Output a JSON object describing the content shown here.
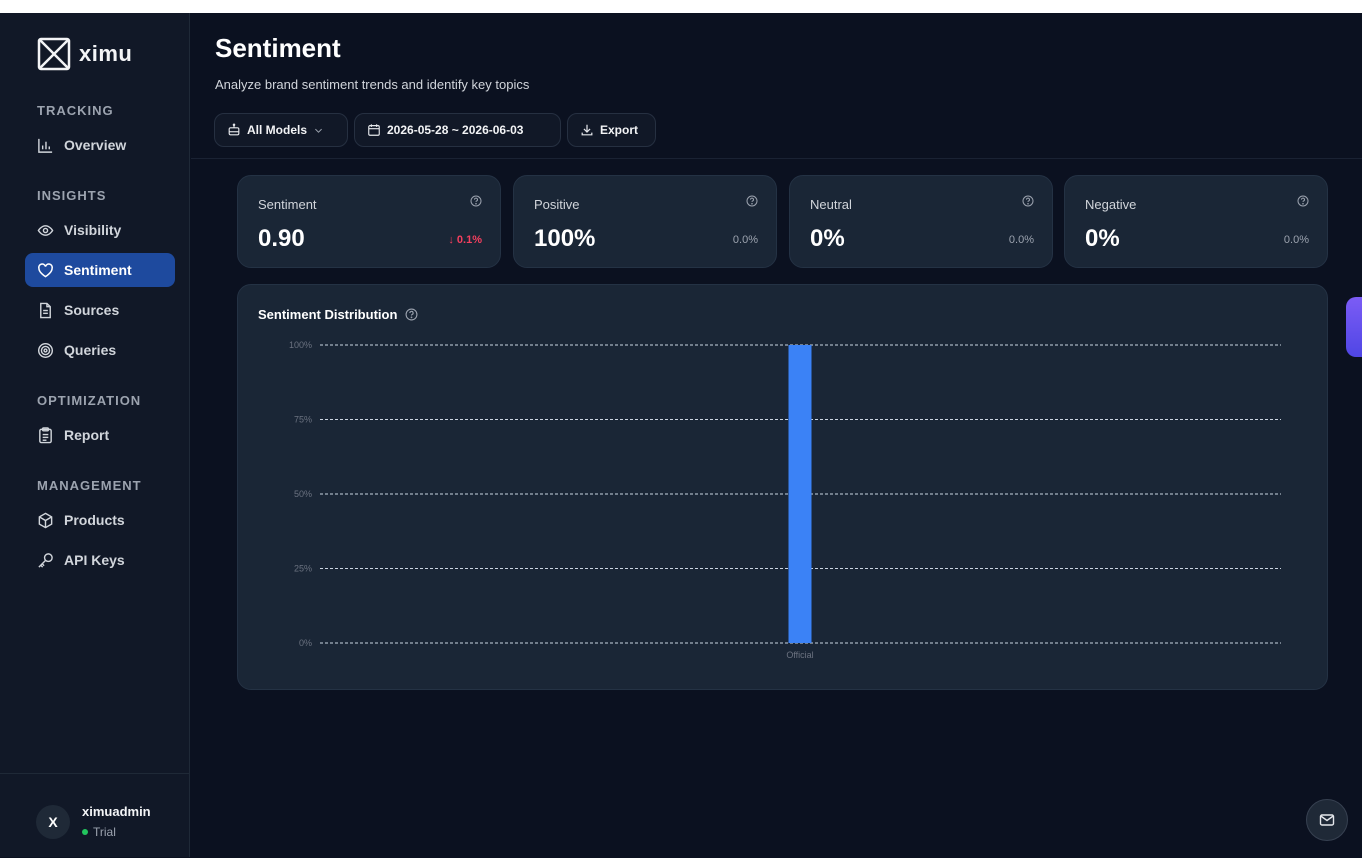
{
  "app": {
    "name": "ximu"
  },
  "sidebar": {
    "sections": [
      {
        "title": "TRACKING",
        "items": [
          {
            "label": "Overview",
            "icon": "bar-chart-icon"
          }
        ]
      },
      {
        "title": "INSIGHTS",
        "items": [
          {
            "label": "Visibility",
            "icon": "eye-icon"
          },
          {
            "label": "Sentiment",
            "icon": "heart-icon",
            "active": true
          },
          {
            "label": "Sources",
            "icon": "file-icon"
          },
          {
            "label": "Queries",
            "icon": "target-icon"
          }
        ]
      },
      {
        "title": "OPTIMIZATION",
        "items": [
          {
            "label": "Report",
            "icon": "clipboard-icon"
          }
        ]
      },
      {
        "title": "MANAGEMENT",
        "items": [
          {
            "label": "Products",
            "icon": "package-icon"
          },
          {
            "label": "API Keys",
            "icon": "key-icon"
          }
        ]
      }
    ]
  },
  "user": {
    "initial": "X",
    "name": "ximuadmin",
    "plan": "Trial"
  },
  "header": {
    "title": "Sentiment",
    "subtitle": "Analyze brand sentiment trends and identify key topics",
    "model_filter": "All Models",
    "date_range": "2026-05-28 ~ 2026-06-03",
    "export_label": "Export"
  },
  "metrics": [
    {
      "label": "Sentiment",
      "value": "0.90",
      "change": "↓ 0.1%",
      "trend": "down"
    },
    {
      "label": "Positive",
      "value": "100%",
      "change": "0.0%",
      "trend": "flat"
    },
    {
      "label": "Neutral",
      "value": "0%",
      "change": "0.0%",
      "trend": "flat"
    },
    {
      "label": "Negative",
      "value": "0%",
      "change": "0.0%",
      "trend": "flat"
    }
  ],
  "chart_data": {
    "type": "bar",
    "title": "Sentiment Distribution",
    "categories": [
      "Official"
    ],
    "values": [
      100
    ],
    "ylim": [
      0,
      100
    ],
    "yticks": [
      "0%",
      "25%",
      "50%",
      "75%",
      "100%"
    ],
    "grid": true,
    "color": "#3b82f6"
  },
  "colors": {
    "accent": "#1e4a9e",
    "bar": "#3b82f6",
    "negative": "#f43f5e",
    "status_ok": "#22c55e"
  }
}
